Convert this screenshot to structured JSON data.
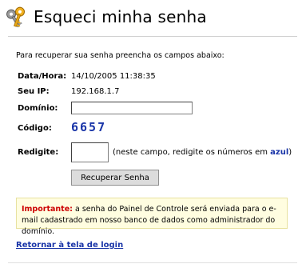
{
  "page": {
    "title": "Esqueci minha senha",
    "intro": "Para recuperar sua senha preencha os campos abaixo:"
  },
  "form": {
    "date_label": "Data/Hora:",
    "date_value": "14/10/2005 11:38:35",
    "ip_label": "Seu IP:",
    "ip_value": "192.168.1.7",
    "domain_label": "Domínio:",
    "domain_value": "",
    "code_label": "Código:",
    "code_value": "6657",
    "retype_label": "Redigite:",
    "retype_value": "",
    "hint_prefix": "(neste campo, redigite os números em ",
    "hint_blue": "azul",
    "hint_suffix": ")",
    "submit_label": "Recuperar Senha"
  },
  "notice": {
    "important": "Importante:",
    "text": " a senha do Painel de Controle será enviada para o e-mail cadastrado em nosso banco de dados como administrador do domínio."
  },
  "links": {
    "back": "Retornar à tela de login"
  },
  "icons": {
    "header": "keys-icon"
  },
  "colors": {
    "accent_blue": "#1a35a8",
    "important_red": "#cc0000",
    "notice_bg": "#fffde0"
  }
}
